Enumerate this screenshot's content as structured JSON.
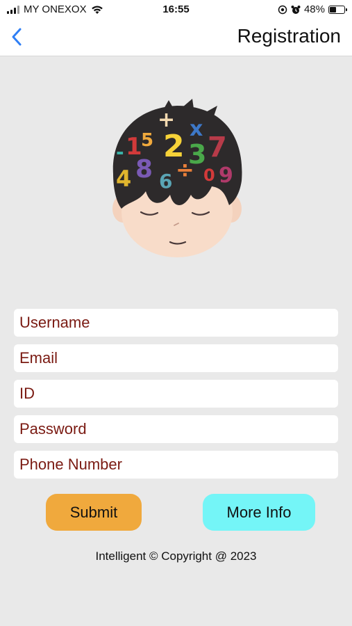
{
  "status_bar": {
    "carrier": "MY ONEXOX",
    "time": "16:55",
    "battery": "48%",
    "battery_level": 0.48,
    "icons": [
      "signal-icon",
      "wifi-icon",
      "location-icon",
      "alarm-icon",
      "battery-icon"
    ]
  },
  "navbar": {
    "back_icon": "chevron-left-icon",
    "title": "Registration"
  },
  "illustration": {
    "glyphs": [
      "+",
      "x",
      "-",
      "1",
      "5",
      "2",
      "3",
      "7",
      "4",
      "8",
      "6",
      "÷",
      "0",
      "9"
    ]
  },
  "form": {
    "username_placeholder": "Username",
    "email_placeholder": "Email",
    "id_placeholder": "ID",
    "password_placeholder": "Password",
    "phone_placeholder": "Phone Number"
  },
  "buttons": {
    "submit": "Submit",
    "more_info": "More Info"
  },
  "footer": {
    "text": "Intelligent © Copyright @ 2023"
  },
  "colors": {
    "placeholder_text": "#7a1a12",
    "submit_bg": "#f0a93d",
    "more_info_bg": "#74f5f7",
    "back_chevron": "#2f7ff5",
    "background": "#e9e9e9"
  }
}
